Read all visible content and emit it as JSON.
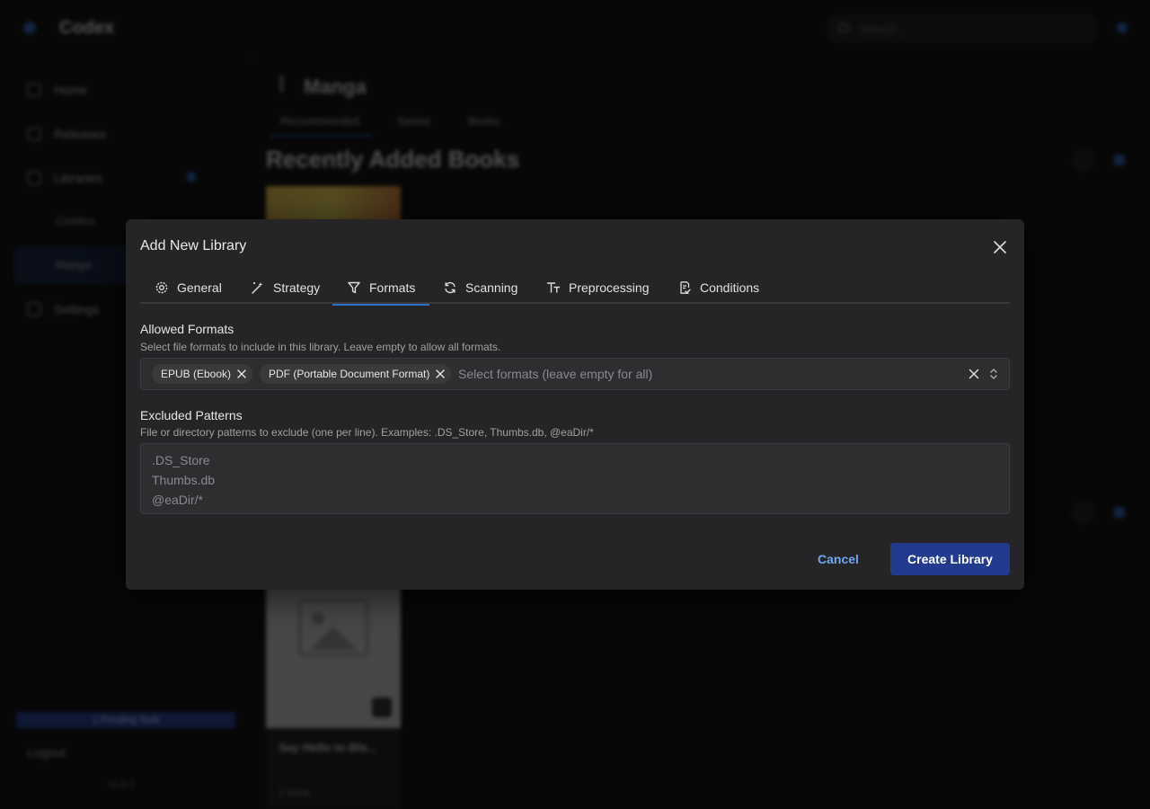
{
  "background": {
    "app_title": "Codex",
    "search_placeholder": "Search...",
    "sidebar": {
      "items": [
        {
          "label": "Home",
          "icon": "home-icon"
        },
        {
          "label": "Releases",
          "icon": "releases-icon"
        },
        {
          "label": "Libraries",
          "icon": "libraries-icon"
        },
        {
          "label": "Comics"
        },
        {
          "label": "Manga"
        },
        {
          "label": "Settings",
          "icon": "settings-icon"
        }
      ],
      "tasks_label": "1 Pending Task",
      "logout_label": "Logout",
      "version": "v1.0.1"
    },
    "main": {
      "title": "Manga",
      "tabs": [
        "Recommended",
        "Series",
        "Books"
      ],
      "section_title": "Recently Added Books",
      "card_title": "Say Hello to Bla...",
      "card_sub": "1 issue"
    }
  },
  "modal": {
    "title": "Add New Library",
    "tabs": [
      {
        "label": "General",
        "icon": "gear-icon"
      },
      {
        "label": "Strategy",
        "icon": "magic-wand-icon"
      },
      {
        "label": "Formats",
        "icon": "filter-icon",
        "active": true
      },
      {
        "label": "Scanning",
        "icon": "refresh-icon"
      },
      {
        "label": "Preprocessing",
        "icon": "text-size-icon"
      },
      {
        "label": "Conditions",
        "icon": "document-check-icon"
      }
    ],
    "allowed_formats": {
      "label": "Allowed Formats",
      "description": "Select file formats to include in this library. Leave empty to allow all formats.",
      "selected": [
        "EPUB (Ebook)",
        "PDF (Portable Document Format)"
      ],
      "placeholder": "Select formats (leave empty for all)"
    },
    "excluded_patterns": {
      "label": "Excluded Patterns",
      "description": "File or directory patterns to exclude (one per line). Examples: .DS_Store, Thumbs.db, @eaDir/*",
      "placeholder_lines": [
        ".DS_Store",
        "Thumbs.db",
        "@eaDir/*"
      ]
    },
    "buttons": {
      "cancel": "Cancel",
      "create": "Create Library"
    }
  },
  "colors": {
    "accent": "#2f6fcf",
    "primary_button": "#233b8f",
    "link": "#6ea8f0",
    "modal_bg": "#252527"
  }
}
